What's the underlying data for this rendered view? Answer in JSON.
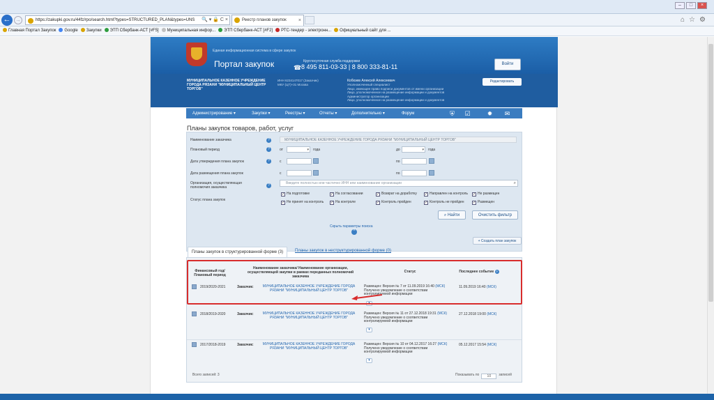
{
  "browser": {
    "url": "https://zakupki.gov.ru/44fz/rpo/search.html?types=STRUCTURED_PLAN&types=UNS",
    "tab_title": "Реестр планов закупок",
    "bookmarks": [
      {
        "label": "Главная Портал Закупок",
        "color": "#d9a400"
      },
      {
        "label": "Google",
        "color": "#4285f4"
      },
      {
        "label": "Закупки",
        "color": "#d9a400"
      },
      {
        "label": "ЭТП Сбербанк-АСТ [#F5]",
        "color": "#2e9d3e"
      },
      {
        "label": "Муниципальная инфор...",
        "color": "#c0c0c0"
      },
      {
        "label": "ЭТП Сбербанк-АСТ [#F2]",
        "color": "#2e9d3e"
      },
      {
        "label": "РТС-тендер - электронн...",
        "color": "#c62828"
      },
      {
        "label": "Официальный сайт для ...",
        "color": "#d9a400"
      }
    ]
  },
  "header": {
    "site_subtitle": "Единая информационная система в сфере закупок",
    "site_title": "Портал закупок",
    "support_label": "Круглосуточная служба поддержки",
    "phones": "8 495 811-03-33   |   8 800 333-81-11",
    "login_label": "Войти"
  },
  "org": {
    "name": "МУНИЦИПАЛЬНОЕ КАЗЕННОЕ УЧРЕЖДЕНИЕ ГОРОДА РЯЗАНИ \"МУНИЦИПАЛЬНЫЙ ЦЕНТР ТОРГОВ\"",
    "ids": "ИНН 6234147017 (Заказчик)\nМКУ (ЦТ)+31 Москва",
    "user_name": "Кобозев Алексей Алексеевич",
    "user_roles": "Уполномоченный специалист\nЛицо, имеющее право подписи документов от имени организации\nЛицо, уполномоченное на размещение информации и документов\nАдминистратор организации\nЛицо, уполномоченное на размещение информации и документов",
    "edit_label": "Редактировать"
  },
  "menu": {
    "items": [
      "Администрирование ▾",
      "Закупки ▾",
      "Реестры ▾",
      "Отчеты ▾",
      "Дополнительно ▾",
      "Форум"
    ],
    "icons": [
      "shield-icon",
      "checklist-icon",
      "settings-icon",
      "messages-icon"
    ]
  },
  "page_title": "Планы закупок товаров, работ, услуг",
  "filter": {
    "customer_label": "Наименование заказчика",
    "customer_value": "МУНИЦИПАЛЬНОЕ КАЗЕННОЕ УЧРЕЖДЕНИЕ ГОРОДА РЯЗАНИ \"МУНИЦИПАЛЬНЫЙ ЦЕНТР ТОРГОВ\"",
    "period_label": "Плановый период",
    "approval_label": "Дата утверждения плана закупок",
    "placement_label": "Дата размещения плана закупок",
    "org_label": "Организация, осуществляющая полномочия заказчика",
    "status_label": "Статус плана закупок",
    "from": "от",
    "to": "до",
    "year": "года",
    "s": "с",
    "po": "по",
    "org_placeholder": "Введите полностью или частично ИНН или наименование организации",
    "statuses": [
      {
        "label": "На подготовке",
        "checked": true
      },
      {
        "label": "На согласовании",
        "checked": true
      },
      {
        "label": "Возврат на доработку",
        "checked": true
      },
      {
        "label": "Направлен на контроль",
        "checked": true
      },
      {
        "label": "Не размещен",
        "checked": true
      },
      {
        "label": "Не принят на контроль",
        "checked": true
      },
      {
        "label": "На контроле",
        "checked": true
      },
      {
        "label": "Контроль пройден",
        "checked": true
      },
      {
        "label": "Контроль не пройден",
        "checked": true
      },
      {
        "label": "Размещен",
        "checked": true
      }
    ],
    "find_label": "Найти",
    "clear_label": "Очистить фильтр",
    "hide_label": "Скрыть параметры поиска"
  },
  "create_label": "+ Создать план закупок",
  "tabs": {
    "active": "Планы закупок в структурированной форме (3)",
    "inactive": "Планы закупок в неструктурированной форме (0)"
  },
  "table": {
    "headers": {
      "period": "Финансовый год/\nПлановый период",
      "customer": "Наименование заказчика/ Наименование организации, осуществляющей закупки в рамках переданных полномочий заказчика",
      "status": "Статус",
      "event": "Последнее событие"
    },
    "customer_label": "Заказчик:",
    "rows": [
      {
        "period": "2019/2020-2021",
        "customer": "МУНИЦИПАЛЬНОЕ КАЗЕННОЕ УЧРЕЖДЕНИЕ ГОРОДА РЯЗАНИ \"МУНИЦИПАЛЬНЫЙ ЦЕНТР ТОРГОВ\"",
        "status": "Размещен: Версия № 7 от 11.09.2019 16:40",
        "status_tz": "(МСК)",
        "status_note": "Получено уведомление о соответствии контролируемой информации",
        "event": "11.09.2019 16:40",
        "event_tz": "(МСК)"
      },
      {
        "period": "2018/2019-2020",
        "customer": "МУНИЦИПАЛЬНОЕ КАЗЕННОЕ УЧРЕЖДЕНИЕ ГОРОДА РЯЗАНИ \"МУНИЦИПАЛЬНЫЙ ЦЕНТР ТОРГОВ\"",
        "status": "Размещен: Версия № 11 от 27.12.2018 19:31",
        "status_tz": "(МСК)",
        "status_note": "Получено уведомление о соответствии контролируемой информации",
        "event": "27.12.2018 19:00",
        "event_tz": "(МСК)"
      },
      {
        "period": "2017/2018-2019",
        "customer": "МУНИЦИПАЛЬНОЕ КАЗЕННОЕ УЧРЕЖДЕНИЕ ГОРОДА РЯЗАНИ \"МУНИЦИПАЛЬНЫЙ ЦЕНТР ТОРГОВ\"",
        "status": "Размещен: Версия № 10 от 04.12.2017 16:27",
        "status_tz": "(МСК)",
        "status_note": "Получено уведомление о соответствии контролируемой информации",
        "event": "05.12.2017 15:54",
        "event_tz": "(МСК)"
      }
    ],
    "total_label": "Всего записей: 3",
    "show_by_label": "Показывать по",
    "page_size": "10",
    "records_label": "записей"
  }
}
